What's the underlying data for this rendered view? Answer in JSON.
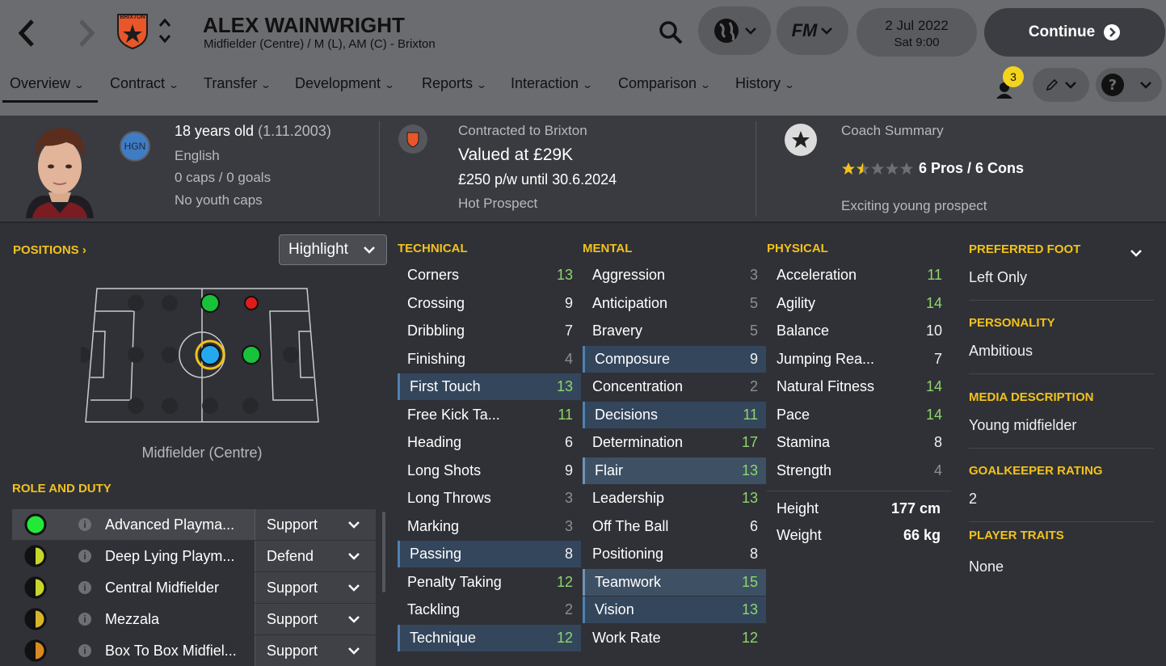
{
  "header": {
    "club_badge_text": "BRIXTON",
    "player_name": "ALEX WAINWRIGHT",
    "player_subtitle": "Midfielder (Centre) / M (L), AM (C) - Brixton",
    "date": "2 Jul 2022",
    "time": "Sat 9:00",
    "continue_label": "Continue",
    "fm_label": "FM",
    "notifications_count": "3"
  },
  "tabs": [
    {
      "label": "Overview"
    },
    {
      "label": "Contract"
    },
    {
      "label": "Transfer"
    },
    {
      "label": "Development"
    },
    {
      "label": "Reports"
    },
    {
      "label": "Interaction"
    },
    {
      "label": "Comparison"
    },
    {
      "label": "History"
    }
  ],
  "info": {
    "nation_code": "HGN",
    "age": "18 years old",
    "dob": "(1.11.2003)",
    "nationality": "English",
    "caps": "0 caps / 0 goals",
    "youth_caps": "No youth caps",
    "contracted": "Contracted to Brixton",
    "value": "Valued at £29K",
    "wage": "£250 p/w until 30.6.2024",
    "status": "Hot Prospect",
    "coach_title": "Coach Summary",
    "coach_rating_stars": 1.5,
    "pros_cons": "6 Pros / 6 Cons",
    "coach_desc": "Exciting young prospect"
  },
  "positions": {
    "title": "POSITIONS",
    "highlight_label": "Highlight",
    "caption": "Midfielder (Centre)"
  },
  "role": {
    "title": "ROLE AND DUTY",
    "rows": [
      {
        "role": "Advanced Playma...",
        "duty": "Support",
        "rating_color": "#22e83a"
      },
      {
        "role": "Deep Lying Playm...",
        "duty": "Defend",
        "rating_color": "#c7d62a"
      },
      {
        "role": "Central Midfielder",
        "duty": "Support",
        "rating_color": "#c7d62a"
      },
      {
        "role": "Mezzala",
        "duty": "Support",
        "rating_color": "#d9b42a"
      },
      {
        "role": "Box To Box Midfiel...",
        "duty": "Support",
        "rating_color": "#d98a20"
      }
    ]
  },
  "technical": {
    "title": "TECHNICAL",
    "rows": [
      {
        "name": "Corners",
        "value": "13"
      },
      {
        "name": "Crossing",
        "value": "9"
      },
      {
        "name": "Dribbling",
        "value": "7"
      },
      {
        "name": "Finishing",
        "value": "4"
      },
      {
        "name": "First Touch",
        "value": "13"
      },
      {
        "name": "Free Kick Ta...",
        "value": "11"
      },
      {
        "name": "Heading",
        "value": "6"
      },
      {
        "name": "Long Shots",
        "value": "9"
      },
      {
        "name": "Long Throws",
        "value": "3"
      },
      {
        "name": "Marking",
        "value": "3"
      },
      {
        "name": "Passing",
        "value": "8"
      },
      {
        "name": "Penalty Taking",
        "value": "12"
      },
      {
        "name": "Tackling",
        "value": "2"
      },
      {
        "name": "Technique",
        "value": "12"
      }
    ]
  },
  "mental": {
    "title": "MENTAL",
    "rows": [
      {
        "name": "Aggression",
        "value": "3"
      },
      {
        "name": "Anticipation",
        "value": "5"
      },
      {
        "name": "Bravery",
        "value": "5"
      },
      {
        "name": "Composure",
        "value": "9"
      },
      {
        "name": "Concentration",
        "value": "2"
      },
      {
        "name": "Decisions",
        "value": "11"
      },
      {
        "name": "Determination",
        "value": "17"
      },
      {
        "name": "Flair",
        "value": "13"
      },
      {
        "name": "Leadership",
        "value": "13"
      },
      {
        "name": "Off The Ball",
        "value": "6"
      },
      {
        "name": "Positioning",
        "value": "8"
      },
      {
        "name": "Teamwork",
        "value": "15"
      },
      {
        "name": "Vision",
        "value": "13"
      },
      {
        "name": "Work Rate",
        "value": "12"
      }
    ]
  },
  "physical": {
    "title": "PHYSICAL",
    "rows": [
      {
        "name": "Acceleration",
        "value": "11"
      },
      {
        "name": "Agility",
        "value": "14"
      },
      {
        "name": "Balance",
        "value": "10"
      },
      {
        "name": "Jumping Rea...",
        "value": "7"
      },
      {
        "name": "Natural Fitness",
        "value": "14"
      },
      {
        "name": "Pace",
        "value": "14"
      },
      {
        "name": "Stamina",
        "value": "8"
      },
      {
        "name": "Strength",
        "value": "4"
      }
    ],
    "height_label": "Height",
    "height": "177 cm",
    "weight_label": "Weight",
    "weight": "66 kg"
  },
  "side": {
    "foot_title": "PREFERRED FOOT",
    "foot": "Left Only",
    "personality_title": "PERSONALITY",
    "personality": "Ambitious",
    "media_title": "MEDIA DESCRIPTION",
    "media": "Young midfielder",
    "gk_title": "GOALKEEPER RATING",
    "gk": "2",
    "traits_title": "PLAYER TRAITS",
    "traits": "None"
  }
}
